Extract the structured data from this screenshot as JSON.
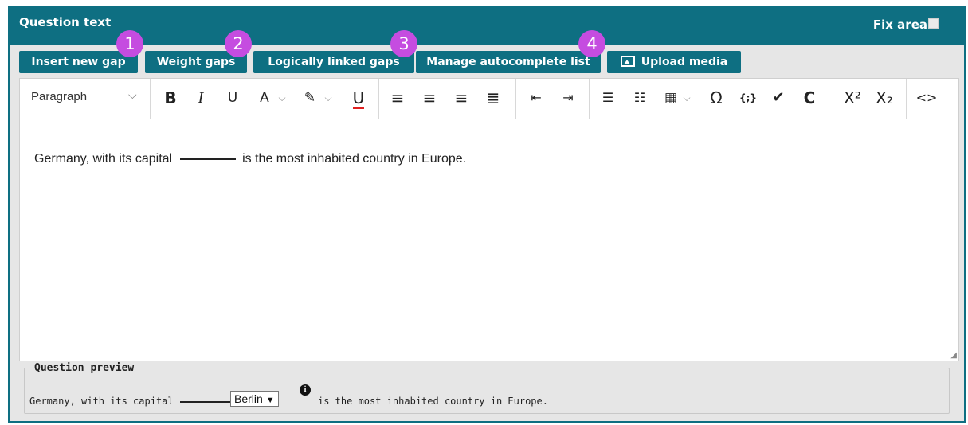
{
  "header": {
    "title": "Question text",
    "fix_area_label": "Fix area"
  },
  "buttons": [
    {
      "label": "Insert new gap",
      "badge": "1"
    },
    {
      "label": "Weight gaps",
      "badge": "2"
    },
    {
      "label": "Logically linked gaps",
      "badge": "3"
    },
    {
      "label": "Manage autocomplete list",
      "badge": "4"
    },
    {
      "label": "Upload media",
      "icon": "image-icon"
    }
  ],
  "toolbar": {
    "paragraph": "Paragraph",
    "bold": "B",
    "italic": "I",
    "underline": "U",
    "font_color": "A",
    "special_char": "Ω",
    "code_braces": "{;}",
    "check": "✔",
    "c_glyph": "C",
    "superscript": "X²",
    "subscript": "X₂",
    "source": "<>"
  },
  "editor": {
    "before_gap": "Germany, with its capital",
    "after_gap": "is the most inhabited country in Europe."
  },
  "preview": {
    "legend": "Question preview",
    "before_gap": "Germany, with its capital",
    "selected_option": "Berlin",
    "after_gap": "is the most inhabited country in Europe."
  },
  "colors": {
    "accent": "#0e6f82",
    "badge": "#c54ce0",
    "panel": "#e6e6e6"
  }
}
